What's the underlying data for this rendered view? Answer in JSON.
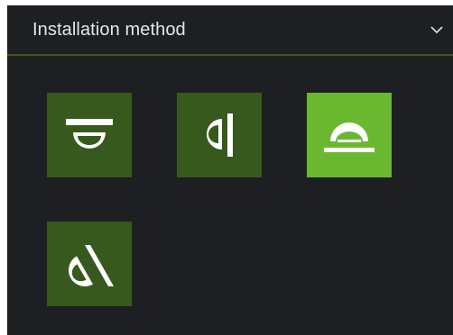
{
  "section": {
    "title": "Installation method",
    "expand_icon": "chevron-down-icon"
  },
  "methods": [
    {
      "icon": "ceiling-mount-icon",
      "selected": false
    },
    {
      "icon": "wall-mount-icon",
      "selected": false
    },
    {
      "icon": "desktop-mount-icon",
      "selected": true
    },
    {
      "icon": "tilted-mount-icon",
      "selected": false
    }
  ],
  "colors": {
    "panel_bg": "#1d1f22",
    "tile": "#37591d",
    "tile_selected": "#6ab830",
    "divider": "#3d5a20",
    "icon": "#ffffff",
    "title_text": "#e6e6e6"
  }
}
